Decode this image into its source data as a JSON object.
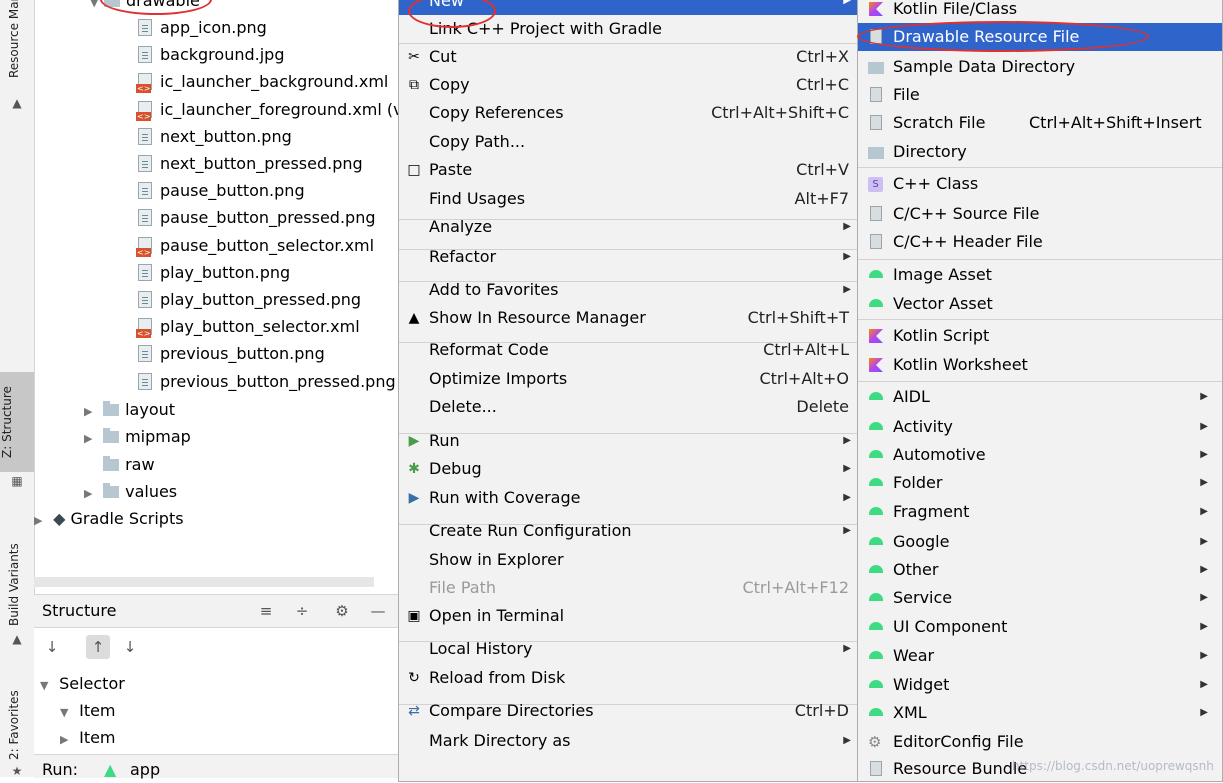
{
  "side_tabs": {
    "resource_manager": "Resource Manager",
    "structure": "Z: Structure",
    "build_variants": "Build Variants",
    "favorites": "2: Favorites"
  },
  "tree": {
    "drawable_folder": "drawable",
    "files": [
      {
        "name": "app_icon.png",
        "type": "png"
      },
      {
        "name": "background.jpg",
        "type": "png"
      },
      {
        "name": "ic_launcher_background.xml",
        "type": "xml"
      },
      {
        "name": "ic_launcher_foreground.xml (v",
        "type": "xml"
      },
      {
        "name": "next_button.png",
        "type": "png"
      },
      {
        "name": "next_button_pressed.png",
        "type": "png"
      },
      {
        "name": "pause_button.png",
        "type": "png"
      },
      {
        "name": "pause_button_pressed.png",
        "type": "png"
      },
      {
        "name": "pause_button_selector.xml",
        "type": "xml"
      },
      {
        "name": "play_button.png",
        "type": "png"
      },
      {
        "name": "play_button_pressed.png",
        "type": "png"
      },
      {
        "name": "play_button_selector.xml",
        "type": "xml"
      },
      {
        "name": "previous_button.png",
        "type": "png"
      },
      {
        "name": "previous_button_pressed.png",
        "type": "png"
      }
    ],
    "folders": [
      "layout",
      "mipmap",
      "raw",
      "values"
    ],
    "gradle_scripts": "Gradle Scripts"
  },
  "structure_panel": {
    "title": "Structure",
    "items": [
      "Selector",
      "Item",
      "Item"
    ]
  },
  "run_bar": {
    "label": "Run:",
    "config": "app"
  },
  "menu": {
    "items": [
      {
        "label": "New",
        "shortcut": "",
        "submenu": true,
        "selected": true
      },
      {
        "label": "Link C++ Project with Gradle",
        "shortcut": ""
      },
      {
        "label": "Cut",
        "shortcut": "Ctrl+X",
        "icon": "scissors-icon"
      },
      {
        "label": "Copy",
        "shortcut": "Ctrl+C",
        "icon": "copy-icon"
      },
      {
        "label": "Copy References",
        "shortcut": "Ctrl+Alt+Shift+C"
      },
      {
        "label": "Copy Path...",
        "shortcut": ""
      },
      {
        "label": "Paste",
        "shortcut": "Ctrl+V",
        "icon": "paste-icon"
      },
      {
        "label": "Find Usages",
        "shortcut": "Alt+F7"
      },
      {
        "label": "Analyze",
        "shortcut": "",
        "submenu": true
      },
      {
        "label": "Refactor",
        "shortcut": "",
        "submenu": true
      },
      {
        "label": "Add to Favorites",
        "shortcut": "",
        "submenu": true
      },
      {
        "label": "Show In Resource Manager",
        "shortcut": "Ctrl+Shift+T",
        "icon": "resource-manager-icon"
      },
      {
        "label": "Reformat Code",
        "shortcut": "Ctrl+Alt+L"
      },
      {
        "label": "Optimize Imports",
        "shortcut": "Ctrl+Alt+O"
      },
      {
        "label": "Delete...",
        "shortcut": "Delete"
      },
      {
        "label": "Run",
        "shortcut": "",
        "submenu": true,
        "icon": "run-icon"
      },
      {
        "label": "Debug",
        "shortcut": "",
        "submenu": true,
        "icon": "debug-icon"
      },
      {
        "label": "Run with Coverage",
        "shortcut": "",
        "submenu": true,
        "icon": "coverage-icon"
      },
      {
        "label": "Create Run Configuration",
        "shortcut": "",
        "submenu": true
      },
      {
        "label": "Show in Explorer",
        "shortcut": ""
      },
      {
        "label": "File Path",
        "shortcut": "Ctrl+Alt+F12",
        "disabled": true
      },
      {
        "label": "Open in Terminal",
        "shortcut": "",
        "icon": "terminal-icon"
      },
      {
        "label": "Local History",
        "shortcut": "",
        "submenu": true
      },
      {
        "label": "Reload from Disk",
        "shortcut": "",
        "icon": "reload-icon"
      },
      {
        "label": "Compare Directories",
        "shortcut": "Ctrl+D",
        "icon": "compare-icon"
      },
      {
        "label": "Mark Directory as",
        "shortcut": "",
        "submenu": true
      }
    ]
  },
  "submenu": {
    "items": [
      {
        "label": "Kotlin File/Class",
        "icon": "kotlin-icon"
      },
      {
        "label": "Drawable Resource File",
        "icon": "xml-file-icon",
        "selected": true
      },
      {
        "label": "Sample Data Directory",
        "icon": "folder-icon"
      },
      {
        "label": "File",
        "icon": "file-icon"
      },
      {
        "label": "Scratch File",
        "shortcut": "Ctrl+Alt+Shift+Insert",
        "icon": "scratch-file-icon"
      },
      {
        "label": "Directory",
        "icon": "folder-icon"
      },
      {
        "label": "C++ Class",
        "icon": "cpp-class-icon"
      },
      {
        "label": "C/C++ Source File",
        "icon": "cpp-source-icon"
      },
      {
        "label": "C/C++ Header File",
        "icon": "cpp-header-icon"
      },
      {
        "label": "Image Asset",
        "icon": "android-icon"
      },
      {
        "label": "Vector Asset",
        "icon": "android-icon"
      },
      {
        "label": "Kotlin Script",
        "icon": "kotlin-icon"
      },
      {
        "label": "Kotlin Worksheet",
        "icon": "kotlin-icon"
      },
      {
        "label": "AIDL",
        "submenu": true,
        "icon": "android-icon"
      },
      {
        "label": "Activity",
        "submenu": true,
        "icon": "android-icon"
      },
      {
        "label": "Automotive",
        "submenu": true,
        "icon": "android-icon"
      },
      {
        "label": "Folder",
        "submenu": true,
        "icon": "android-icon"
      },
      {
        "label": "Fragment",
        "submenu": true,
        "icon": "android-icon"
      },
      {
        "label": "Google",
        "submenu": true,
        "icon": "android-icon"
      },
      {
        "label": "Other",
        "submenu": true,
        "icon": "android-icon"
      },
      {
        "label": "Service",
        "submenu": true,
        "icon": "android-icon"
      },
      {
        "label": "UI Component",
        "submenu": true,
        "icon": "android-icon"
      },
      {
        "label": "Wear",
        "submenu": true,
        "icon": "android-icon"
      },
      {
        "label": "Widget",
        "submenu": true,
        "icon": "android-icon"
      },
      {
        "label": "XML",
        "submenu": true,
        "icon": "android-icon"
      },
      {
        "label": "EditorConfig File",
        "icon": "gear-icon"
      },
      {
        "label": "Resource Bundle",
        "icon": "resource-bundle-icon"
      }
    ]
  },
  "watermark": "https://blog.csdn.net/uoprewqsnh",
  "colors": {
    "selection": "#2f65ca",
    "highlight_ring": "#e03030"
  }
}
